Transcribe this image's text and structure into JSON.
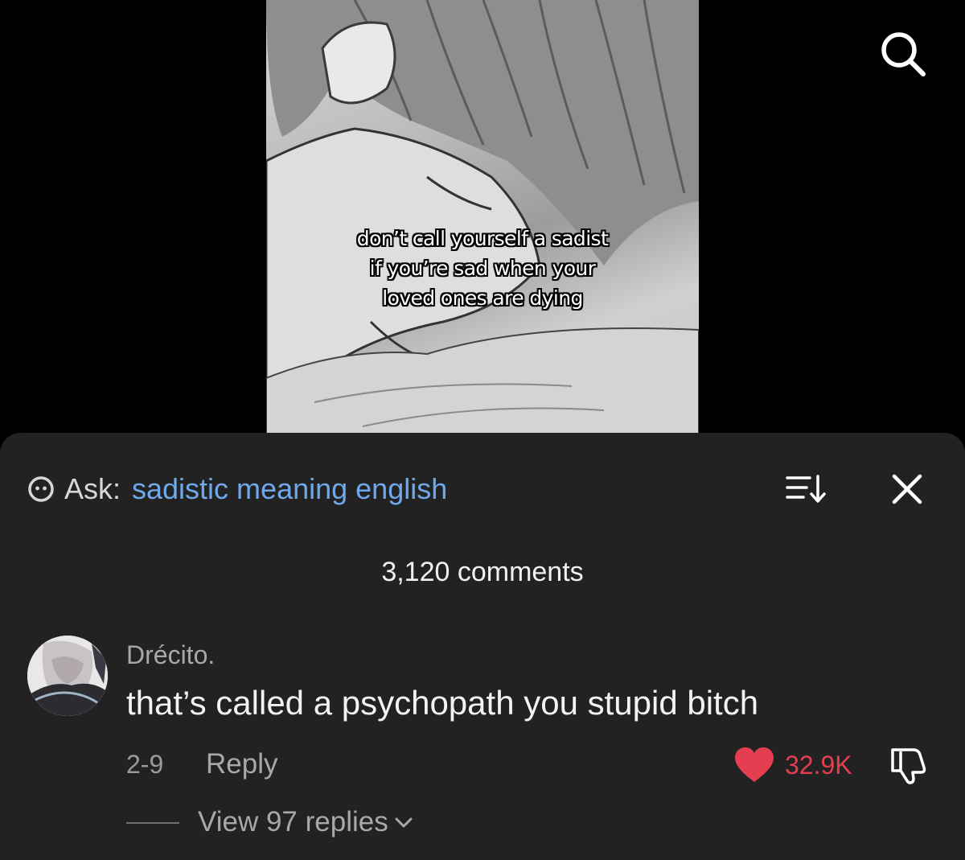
{
  "video": {
    "caption_lines": [
      "don’t call yourself a sadist",
      "if you’re sad when your",
      "loved ones are dying"
    ]
  },
  "icons": {
    "search": "search-icon",
    "ask": "smiley-icon",
    "sort": "sort-icon",
    "close": "close-icon",
    "like": "heart-icon",
    "dislike": "thumbs-down-icon",
    "expand": "chevron-down-icon"
  },
  "ask": {
    "label": "Ask:",
    "query": "sadistic meaning english"
  },
  "comments_header": {
    "count_text": "3,120 comments"
  },
  "comment": {
    "username": "Drécito.",
    "text": "that’s called a psychopath you stupid bitch",
    "date": "2-9",
    "reply_label": "Reply",
    "like_count": "32.9K",
    "view_replies_label": "View 97 replies"
  },
  "colors": {
    "sheet_bg": "#222222",
    "link_blue": "#6fa9ec",
    "like_red": "#e63e51",
    "muted_text": "#a8a8a8"
  }
}
